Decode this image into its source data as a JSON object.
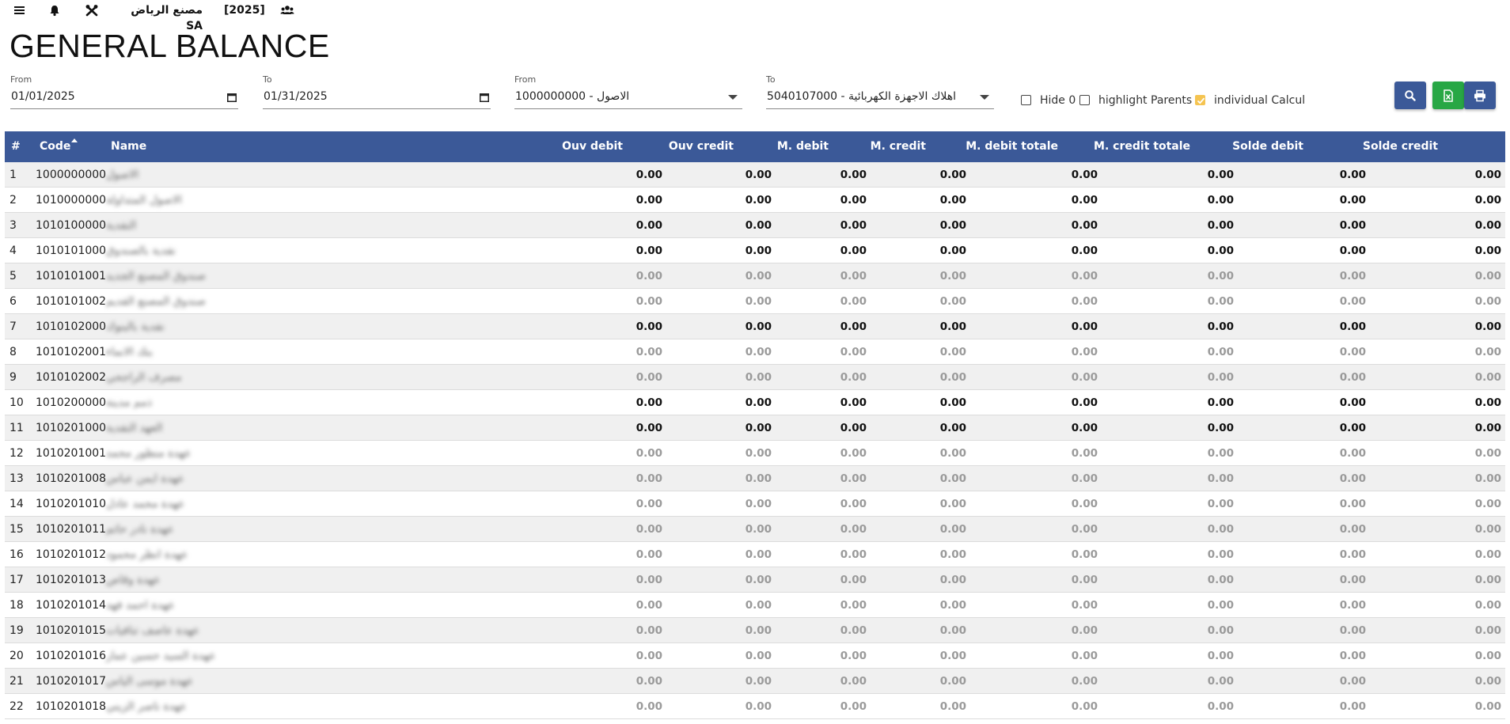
{
  "topbar": {
    "company": "مصنع الرياض SA",
    "year": "[2025]",
    "icons": [
      "menu-icon",
      "bell-icon",
      "tools-icon",
      "users-icon"
    ]
  },
  "page_title": "GENERAL BALANCE",
  "filters": {
    "date_from": {
      "label": "From",
      "value": "01/01/2025"
    },
    "date_to": {
      "label": "To",
      "value": "01/31/2025"
    },
    "account_from": {
      "label": "From",
      "value": "1000000000 - الاصول"
    },
    "account_to": {
      "label": "To",
      "value": "5040107000 - اهلاك الاجهزة الكهربائية"
    },
    "hide_zero": {
      "label": "Hide 0",
      "checked": false
    },
    "highlight_parents": {
      "label": "highlight Parents",
      "checked": false
    },
    "individual_calcul": {
      "label": "individual Calcul",
      "checked": true
    }
  },
  "actions": {
    "search": {
      "icon": "search-icon",
      "color": "#3b5998"
    },
    "excel": {
      "icon": "file-excel-icon",
      "color": "#28a745"
    },
    "print": {
      "icon": "print-icon",
      "color": "#3b5998"
    }
  },
  "colors": {
    "header_bg": "#3b5998",
    "checkbox_on": "#f5c451"
  },
  "table": {
    "columns": [
      "#",
      "Code",
      "Name",
      "Ouv debit",
      "Ouv credit",
      "M. debit",
      "M. credit",
      "M. debit totale",
      "M. credit totale",
      "Solde debit",
      "Solde credit"
    ],
    "rows": [
      {
        "n": "1",
        "code": "1000000000",
        "name": "الاصول",
        "parent": true,
        "values": [
          "0.00",
          "0.00",
          "0.00",
          "0.00",
          "0.00",
          "0.00",
          "0.00",
          "0.00"
        ]
      },
      {
        "n": "2",
        "code": "1010000000",
        "name": "الاصول المتداولة",
        "parent": true,
        "values": [
          "0.00",
          "0.00",
          "0.00",
          "0.00",
          "0.00",
          "0.00",
          "0.00",
          "0.00"
        ]
      },
      {
        "n": "3",
        "code": "1010100000",
        "name": "النقدية",
        "parent": true,
        "values": [
          "0.00",
          "0.00",
          "0.00",
          "0.00",
          "0.00",
          "0.00",
          "0.00",
          "0.00"
        ]
      },
      {
        "n": "4",
        "code": "1010101000",
        "name": "نقدية بالصندوق",
        "parent": true,
        "values": [
          "0.00",
          "0.00",
          "0.00",
          "0.00",
          "0.00",
          "0.00",
          "0.00",
          "0.00"
        ]
      },
      {
        "n": "5",
        "code": "1010101001",
        "name": "صندوق المصنع الجديد",
        "parent": false,
        "values": [
          "0.00",
          "0.00",
          "0.00",
          "0.00",
          "0.00",
          "0.00",
          "0.00",
          "0.00"
        ]
      },
      {
        "n": "6",
        "code": "1010101002",
        "name": "صندوق المصنع القديم",
        "parent": false,
        "values": [
          "0.00",
          "0.00",
          "0.00",
          "0.00",
          "0.00",
          "0.00",
          "0.00",
          "0.00"
        ]
      },
      {
        "n": "7",
        "code": "1010102000",
        "name": "نقدية بالبنوك",
        "parent": true,
        "values": [
          "0.00",
          "0.00",
          "0.00",
          "0.00",
          "0.00",
          "0.00",
          "0.00",
          "0.00"
        ]
      },
      {
        "n": "8",
        "code": "1010102001",
        "name": "بنك الانماء",
        "parent": false,
        "values": [
          "0.00",
          "0.00",
          "0.00",
          "0.00",
          "0.00",
          "0.00",
          "0.00",
          "0.00"
        ]
      },
      {
        "n": "9",
        "code": "1010102002",
        "name": "مصرف الراجحي",
        "parent": false,
        "values": [
          "0.00",
          "0.00",
          "0.00",
          "0.00",
          "0.00",
          "0.00",
          "0.00",
          "0.00"
        ]
      },
      {
        "n": "10",
        "code": "1010200000",
        "name": "ذمم مدينة",
        "parent": true,
        "values": [
          "0.00",
          "0.00",
          "0.00",
          "0.00",
          "0.00",
          "0.00",
          "0.00",
          "0.00"
        ]
      },
      {
        "n": "11",
        "code": "1010201000",
        "name": "العهد النقدية",
        "parent": true,
        "values": [
          "0.00",
          "0.00",
          "0.00",
          "0.00",
          "0.00",
          "0.00",
          "0.00",
          "0.00"
        ]
      },
      {
        "n": "12",
        "code": "1010201001",
        "name": "عهدة منظور محمد",
        "parent": false,
        "values": [
          "0.00",
          "0.00",
          "0.00",
          "0.00",
          "0.00",
          "0.00",
          "0.00",
          "0.00"
        ]
      },
      {
        "n": "13",
        "code": "1010201008",
        "name": "عهدة ايمن عباس",
        "parent": false,
        "values": [
          "0.00",
          "0.00",
          "0.00",
          "0.00",
          "0.00",
          "0.00",
          "0.00",
          "0.00"
        ]
      },
      {
        "n": "14",
        "code": "1010201010",
        "name": "عهدة محمد عادل",
        "parent": false,
        "values": [
          "0.00",
          "0.00",
          "0.00",
          "0.00",
          "0.00",
          "0.00",
          "0.00",
          "0.00"
        ]
      },
      {
        "n": "15",
        "code": "1010201011",
        "name": "عهدة نادر حاتم",
        "parent": false,
        "values": [
          "0.00",
          "0.00",
          "0.00",
          "0.00",
          "0.00",
          "0.00",
          "0.00",
          "0.00"
        ]
      },
      {
        "n": "16",
        "code": "1010201012",
        "name": "عهدة انظر محمود",
        "parent": false,
        "values": [
          "0.00",
          "0.00",
          "0.00",
          "0.00",
          "0.00",
          "0.00",
          "0.00",
          "0.00"
        ]
      },
      {
        "n": "17",
        "code": "1010201013",
        "name": "عهدة وقاص",
        "parent": false,
        "values": [
          "0.00",
          "0.00",
          "0.00",
          "0.00",
          "0.00",
          "0.00",
          "0.00",
          "0.00"
        ]
      },
      {
        "n": "18",
        "code": "1010201014",
        "name": "عهدة احمد فهد",
        "parent": false,
        "values": [
          "0.00",
          "0.00",
          "0.00",
          "0.00",
          "0.00",
          "0.00",
          "0.00",
          "0.00"
        ]
      },
      {
        "n": "19",
        "code": "1010201015",
        "name": "عهدة عاصف تنافيات",
        "parent": false,
        "values": [
          "0.00",
          "0.00",
          "0.00",
          "0.00",
          "0.00",
          "0.00",
          "0.00",
          "0.00"
        ]
      },
      {
        "n": "20",
        "code": "1010201016",
        "name": "عهدة السيد حسين عمار",
        "parent": false,
        "values": [
          "0.00",
          "0.00",
          "0.00",
          "0.00",
          "0.00",
          "0.00",
          "0.00",
          "0.00"
        ]
      },
      {
        "n": "21",
        "code": "1010201017",
        "name": "عهدة موسى الياس",
        "parent": false,
        "values": [
          "0.00",
          "0.00",
          "0.00",
          "0.00",
          "0.00",
          "0.00",
          "0.00",
          "0.00"
        ]
      },
      {
        "n": "22",
        "code": "1010201018",
        "name": "عهدة ناصر الزيني",
        "parent": false,
        "values": [
          "0.00",
          "0.00",
          "0.00",
          "0.00",
          "0.00",
          "0.00",
          "0.00",
          "0.00"
        ]
      }
    ]
  }
}
